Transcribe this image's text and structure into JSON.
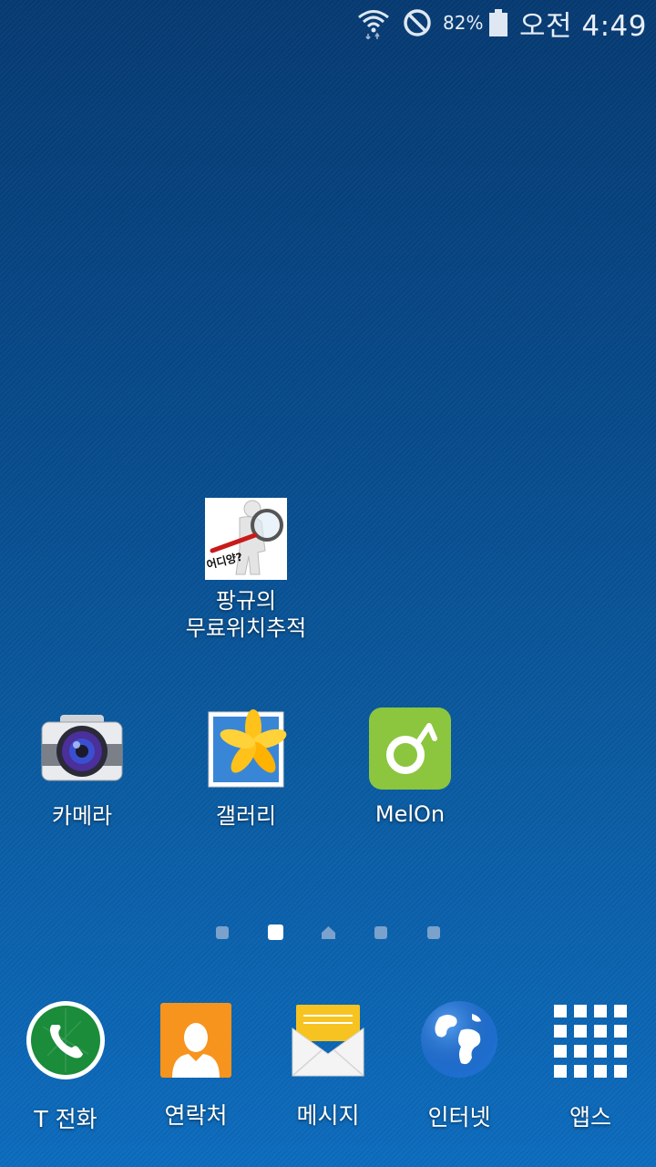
{
  "status_bar": {
    "battery_percent": "82%",
    "clock": "오전 4:49",
    "icons": [
      "wifi-icon",
      "do-not-disturb-icon",
      "battery-icon"
    ]
  },
  "home_apps": [
    {
      "label_line1": "팡규의",
      "label_line2": "무료위치추적",
      "icon_text": "어디양?"
    },
    {
      "label": "카메라"
    },
    {
      "label": "갤러리"
    },
    {
      "label": "MelOn"
    }
  ],
  "page_indicator": {
    "pages": 5,
    "active_index": 1,
    "home_index": 2
  },
  "dock": [
    {
      "label": "T 전화"
    },
    {
      "label": "연락처"
    },
    {
      "label": "메시지"
    },
    {
      "label": "인터넷"
    },
    {
      "label": "앱스"
    }
  ],
  "colors": {
    "melon_green": "#8cc63f",
    "contacts_orange": "#f7941d",
    "phone_green": "#1a8c3a",
    "message_yellow": "#f6c321"
  }
}
